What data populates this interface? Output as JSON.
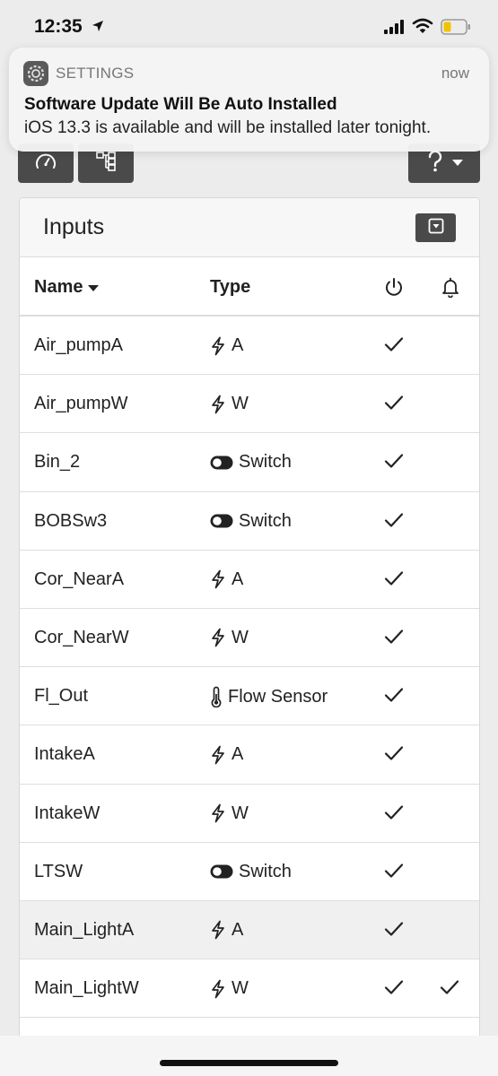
{
  "status": {
    "time": "12:35"
  },
  "notification": {
    "app": "SETTINGS",
    "time": "now",
    "title": "Software Update Will Be Auto Installed",
    "body": "iOS 13.3 is available and will be installed later tonight."
  },
  "toolbar": {
    "buttons": [
      {
        "icon": "dashboard-gauge-icon"
      },
      {
        "icon": "hierarchy-icon"
      },
      {
        "icon": "help-dropdown-icon"
      }
    ]
  },
  "panel": {
    "title": "Inputs",
    "collapse_icon": "collapse-icon"
  },
  "table": {
    "columns": {
      "name": "Name",
      "type": "Type",
      "enabled_icon": "power-icon",
      "alert_icon": "bell-icon"
    },
    "rows": [
      {
        "name": "Air_pumpA",
        "type": "A",
        "icon": "bolt",
        "enabled": true,
        "alert": false
      },
      {
        "name": "Air_pumpW",
        "type": "W",
        "icon": "bolt",
        "enabled": true,
        "alert": false
      },
      {
        "name": "Bin_2",
        "type": "Switch",
        "icon": "toggle",
        "enabled": true,
        "alert": false
      },
      {
        "name": "BOBSw3",
        "type": "Switch",
        "icon": "toggle",
        "enabled": true,
        "alert": false
      },
      {
        "name": "Cor_NearA",
        "type": "A",
        "icon": "bolt",
        "enabled": true,
        "alert": false
      },
      {
        "name": "Cor_NearW",
        "type": "W",
        "icon": "bolt",
        "enabled": true,
        "alert": false
      },
      {
        "name": "Fl_Out",
        "type": "Flow Sensor",
        "icon": "thermometer",
        "enabled": true,
        "alert": false
      },
      {
        "name": "IntakeA",
        "type": "A",
        "icon": "bolt",
        "enabled": true,
        "alert": false
      },
      {
        "name": "IntakeW",
        "type": "W",
        "icon": "bolt",
        "enabled": true,
        "alert": false
      },
      {
        "name": "LTSW",
        "type": "Switch",
        "icon": "toggle",
        "enabled": true,
        "alert": false
      },
      {
        "name": "Main_LightA",
        "type": "A",
        "icon": "bolt",
        "enabled": true,
        "alert": false,
        "highlighted": true
      },
      {
        "name": "Main_LightW",
        "type": "W",
        "icon": "bolt",
        "enabled": true,
        "alert": true
      }
    ]
  }
}
